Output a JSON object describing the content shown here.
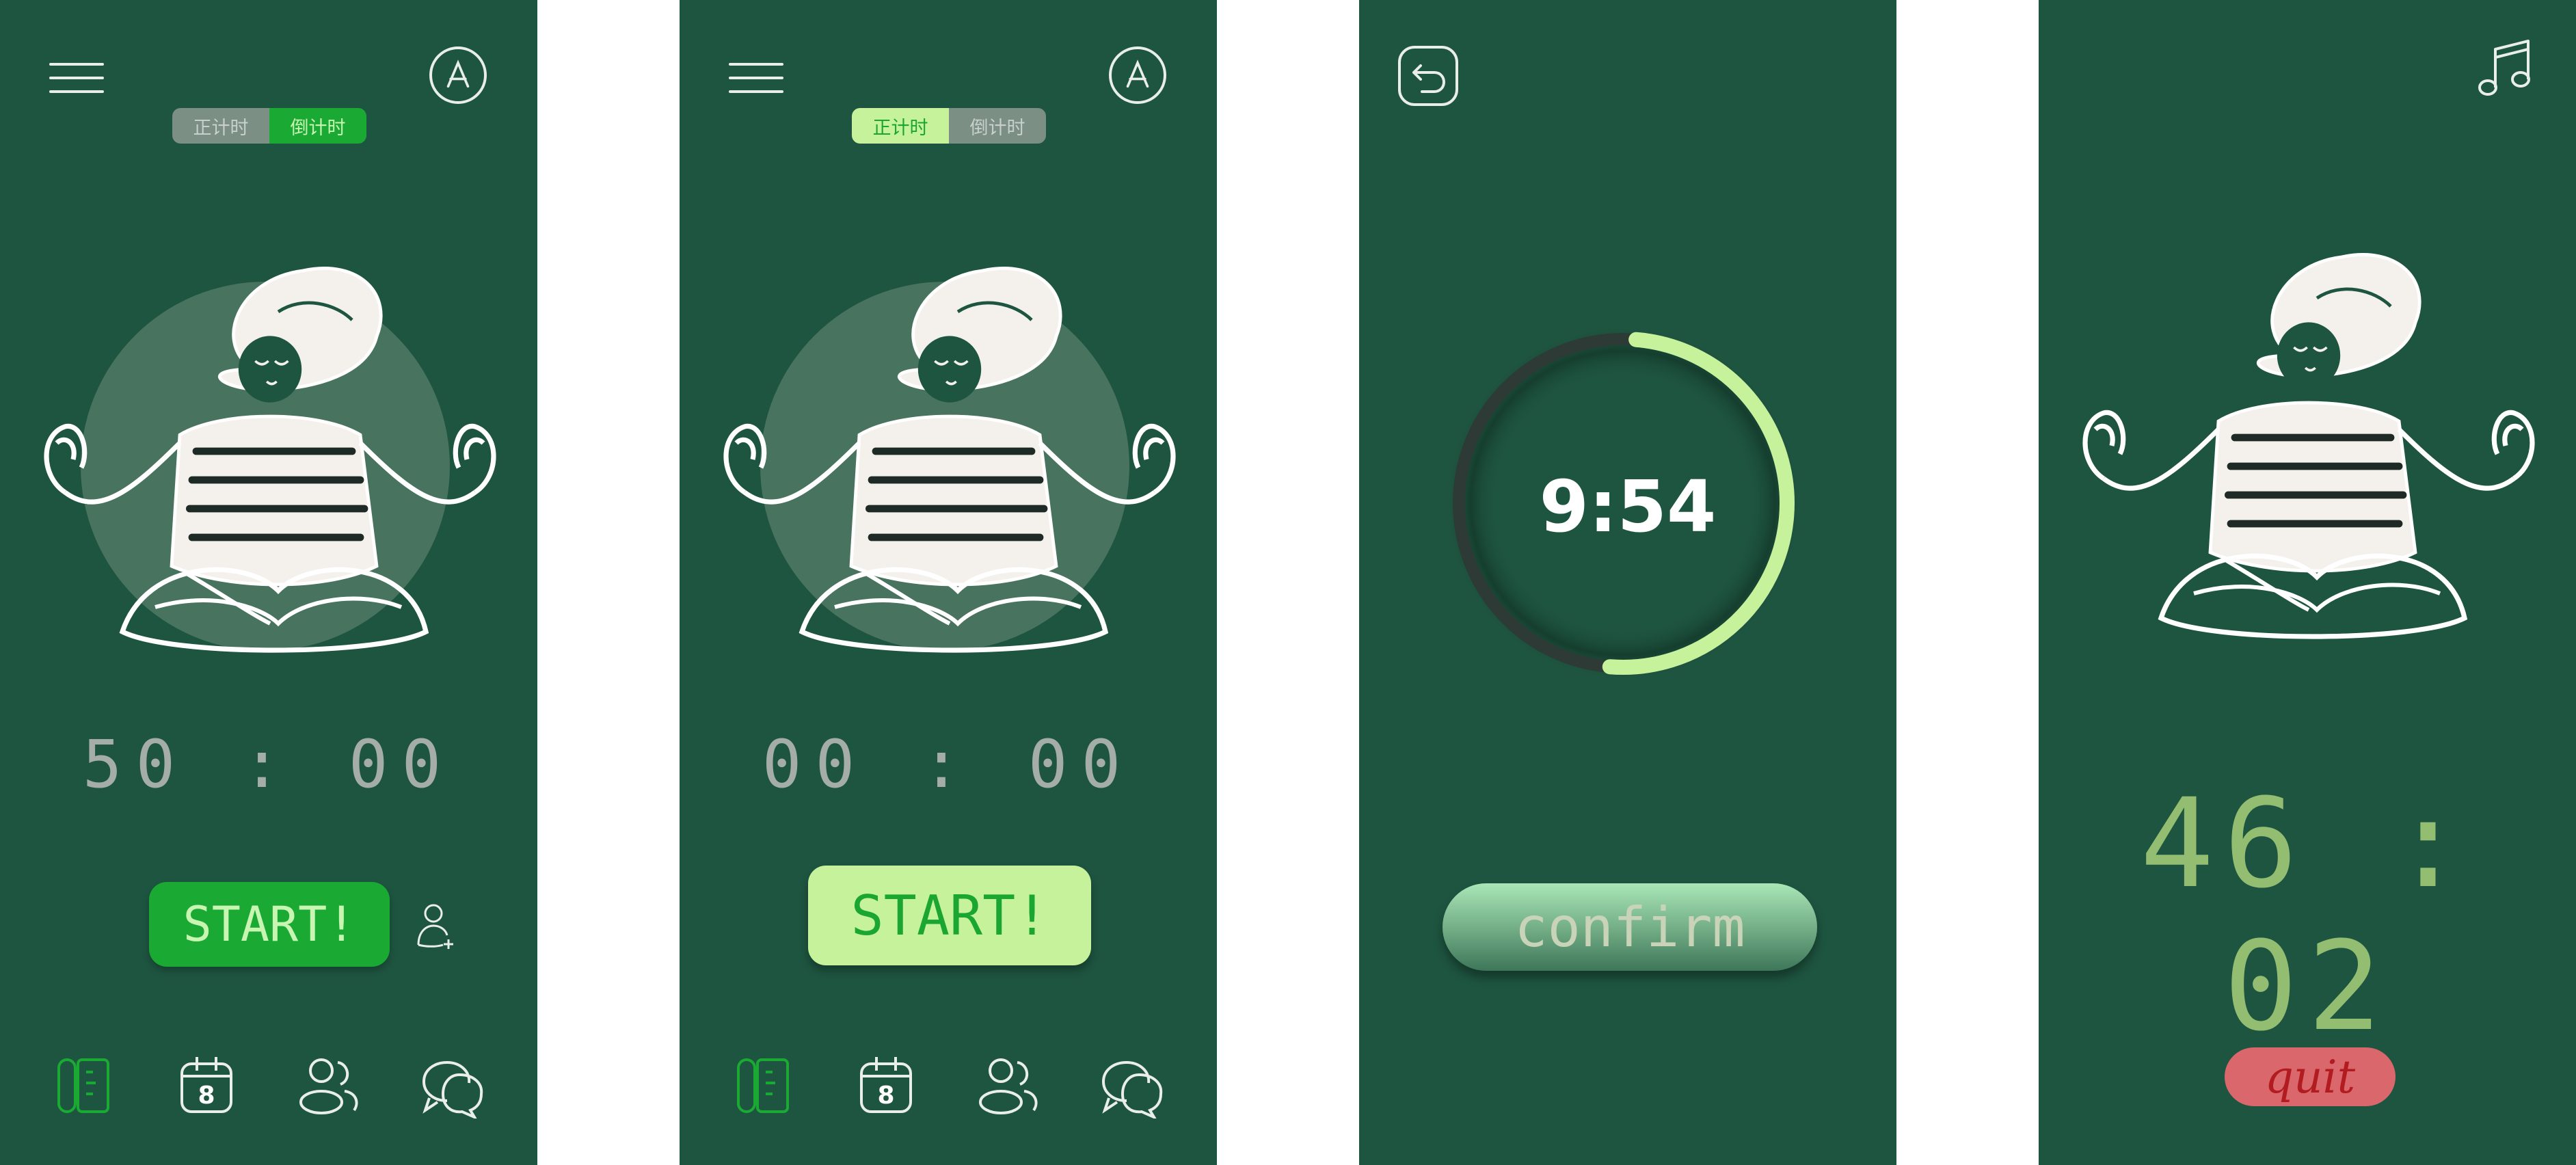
{
  "toggle": {
    "count_up_label": "正计时",
    "count_down_label": "倒计时"
  },
  "screen1": {
    "timer": "50 : 00",
    "start_label": "START!",
    "selected_mode": "countdown"
  },
  "screen2": {
    "timer": "00 : 00",
    "start_label": "START!",
    "selected_mode": "count_up"
  },
  "screen3": {
    "remaining": "9:54",
    "progress": 0.5,
    "confirm_label": "confirm"
  },
  "screen4": {
    "timer": "46 : 02",
    "quit_label": "quit"
  },
  "nav": {
    "calendar_day": "8"
  },
  "icons": [
    "menu-icon",
    "avatar-icon",
    "add-user-icon",
    "timer-icon",
    "calendar-icon",
    "friends-icon",
    "chat-icon",
    "back-icon",
    "music-icon"
  ],
  "colors": {
    "background": "#1e5540",
    "accent_green": "#1aaa34",
    "accent_lime": "#c6f29c",
    "ring": "#c6f29c",
    "quit": "#d9676c"
  }
}
